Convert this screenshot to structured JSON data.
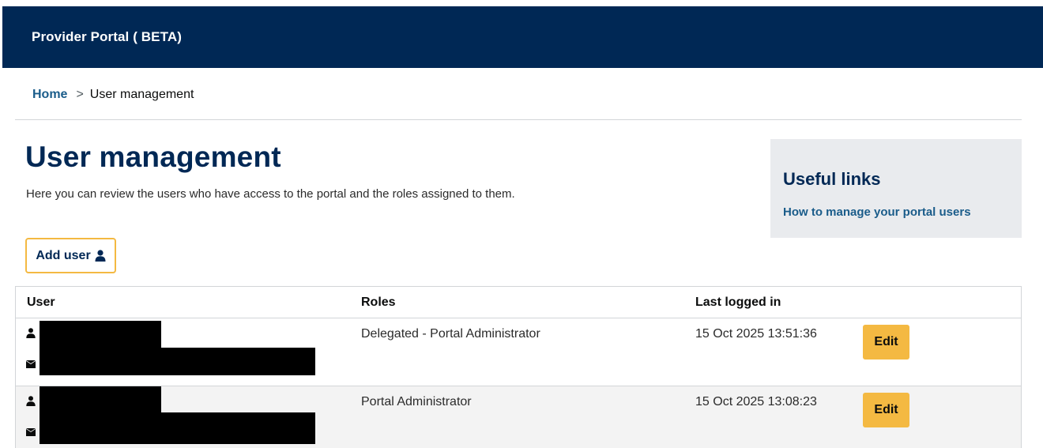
{
  "header": {
    "title": "Provider Portal ( BETA)"
  },
  "breadcrumb": {
    "home": "Home",
    "separator": ">",
    "current": "User management"
  },
  "page": {
    "title": "User management",
    "intro": "Here you can review the users who have access to the portal and the roles assigned to them."
  },
  "useful_links": {
    "heading": "Useful links",
    "links": [
      "How to manage your portal users"
    ]
  },
  "add_user": {
    "label": "Add user"
  },
  "table": {
    "headers": [
      "User",
      "Roles",
      "Last logged in"
    ],
    "rows": [
      {
        "role": "Delegated - Portal Administrator",
        "last_logged_in": "15 Oct 2025 13:51:36",
        "action": "Edit"
      },
      {
        "role": "Portal Administrator",
        "last_logged_in": "15 Oct 2025 13:08:23",
        "action": "Edit"
      }
    ]
  },
  "colors": {
    "header_bg": "#002855",
    "accent": "#f4b942",
    "link": "#1a5c8a",
    "panel_bg": "#e9ebee"
  },
  "icons": {
    "user": "user-icon",
    "email": "envelope-icon"
  }
}
